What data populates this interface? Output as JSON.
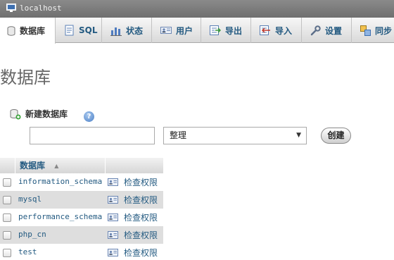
{
  "window": {
    "host": "localhost"
  },
  "tabs": [
    {
      "label": "数据库",
      "icon": "database-icon"
    },
    {
      "label": "SQL",
      "icon": "sql-document-icon"
    },
    {
      "label": "状态",
      "icon": "status-chart-icon"
    },
    {
      "label": "用户",
      "icon": "users-icon"
    },
    {
      "label": "导出",
      "icon": "export-icon"
    },
    {
      "label": "导入",
      "icon": "import-icon"
    },
    {
      "label": "设置",
      "icon": "wrench-icon"
    },
    {
      "label": "同步",
      "icon": "sync-icon"
    }
  ],
  "page": {
    "title": "数据库"
  },
  "create": {
    "label": "新建数据库",
    "name_value": "",
    "collation": "整理",
    "button": "创建"
  },
  "table": {
    "header": "数据库",
    "rows": [
      {
        "name": "information_schema",
        "action": "检查权限"
      },
      {
        "name": "mysql",
        "action": "检查权限"
      },
      {
        "name": "performance_schema",
        "action": "检查权限"
      },
      {
        "name": "php_cn",
        "action": "检查权限"
      },
      {
        "name": "test",
        "action": "检查权限"
      }
    ]
  }
}
